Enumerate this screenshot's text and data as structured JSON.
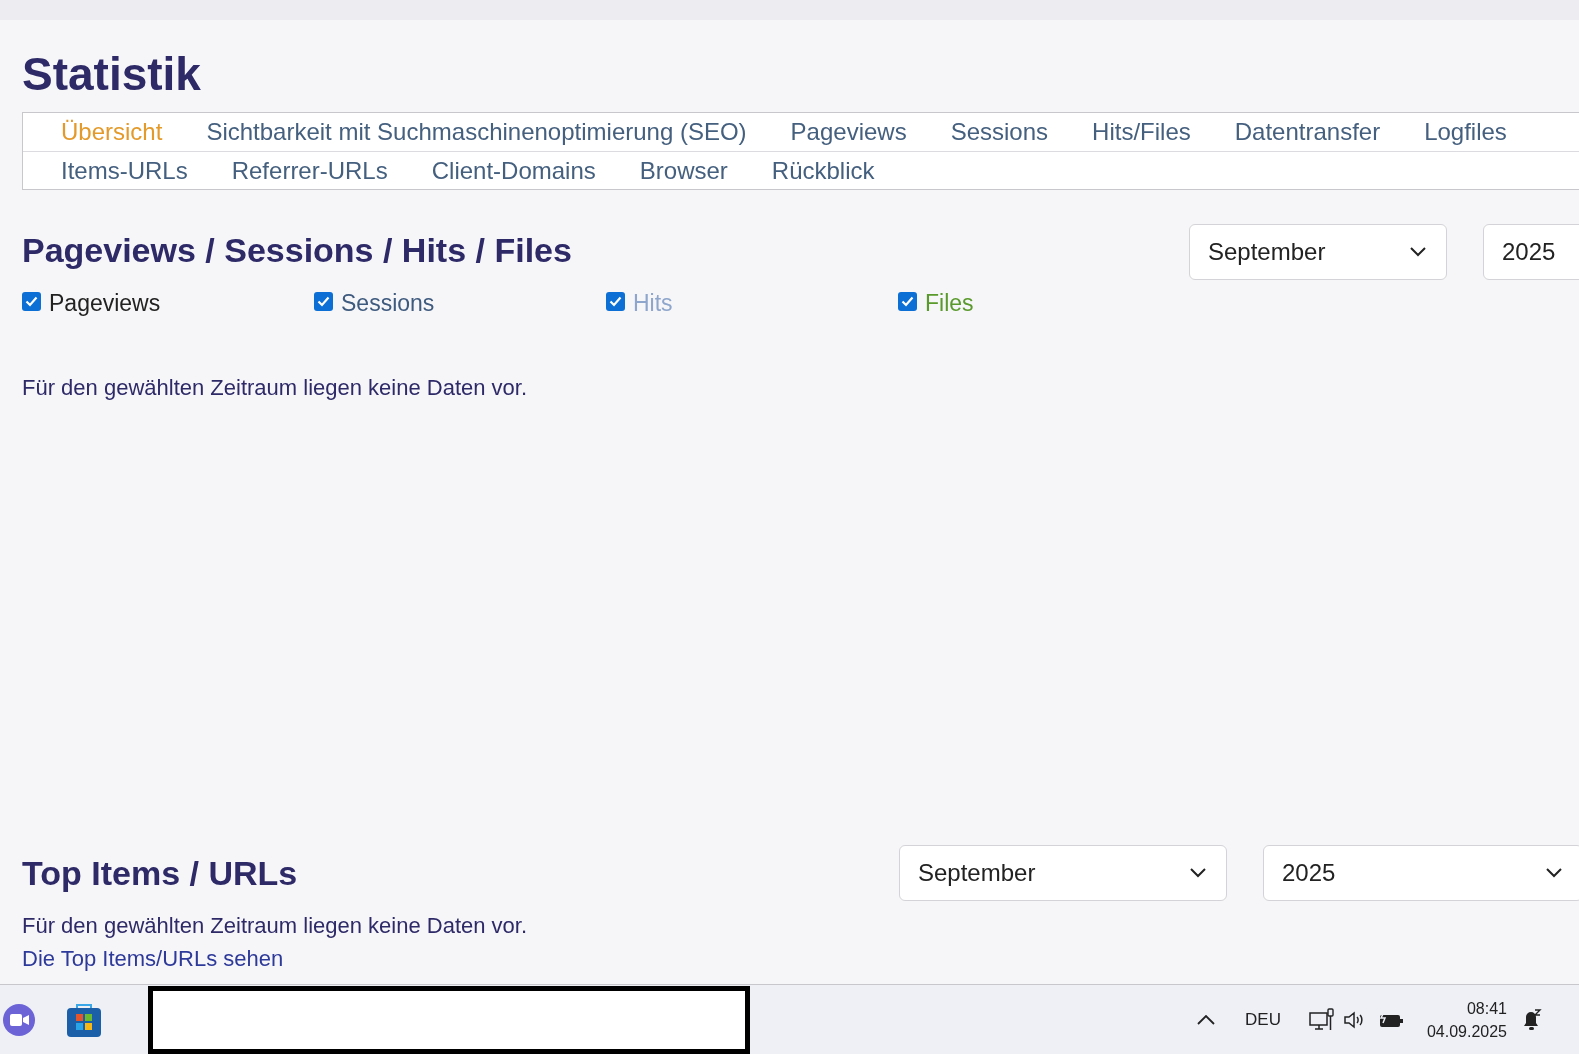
{
  "page_title": "Statistik",
  "nav_tabs": [
    [
      {
        "label": "Übersicht",
        "selected": true
      },
      {
        "label": "Sichtbarkeit mit Suchmaschinenoptimierung (SEO)",
        "selected": false
      },
      {
        "label": "Pageviews",
        "selected": false
      },
      {
        "label": "Sessions",
        "selected": false
      },
      {
        "label": "Hits/Files",
        "selected": false
      },
      {
        "label": "Datentransfer",
        "selected": false
      },
      {
        "label": "Logfiles",
        "selected": false
      }
    ],
    [
      {
        "label": "Items-URLs",
        "selected": false
      },
      {
        "label": "Referrer-URLs",
        "selected": false
      },
      {
        "label": "Client-Domains",
        "selected": false
      },
      {
        "label": "Browser",
        "selected": false
      },
      {
        "label": "Rückblick",
        "selected": false
      }
    ]
  ],
  "traffic_section": {
    "heading": "Pageviews / Sessions / Hits / Files",
    "month": "September",
    "year": "2025",
    "series_toggles": [
      {
        "label": "Pageviews",
        "checked": true,
        "color": "#222222"
      },
      {
        "label": "Sessions",
        "checked": true,
        "color": "#3e5a7e"
      },
      {
        "label": "Hits",
        "checked": true,
        "color": "#8ea6cc"
      },
      {
        "label": "Files",
        "checked": true,
        "color": "#5a9a2c"
      }
    ],
    "message": "Für den gewählten Zeitraum liegen keine Daten vor."
  },
  "top_items_section": {
    "heading": "Top Items / URLs",
    "month": "September",
    "year": "2025",
    "message": "Für den gewählten Zeitraum liegen keine Daten vor.",
    "link": "Die Top Items/URLs sehen"
  },
  "taskbar": {
    "language": "DEU",
    "time": "08:41",
    "date": "04.09.2025"
  }
}
